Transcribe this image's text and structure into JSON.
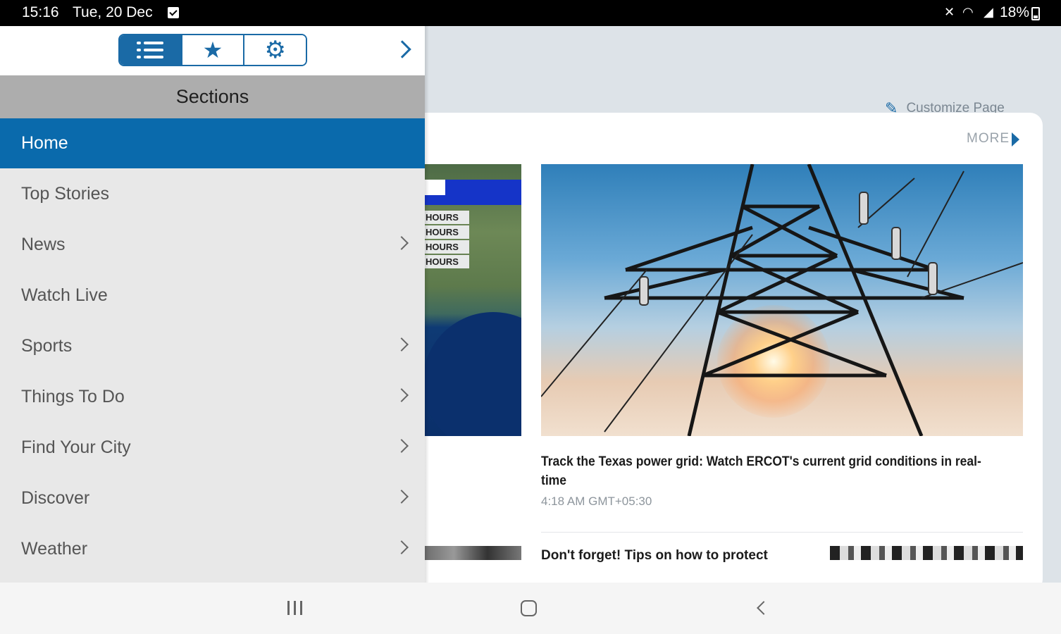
{
  "status_bar": {
    "time": "15:16",
    "date": "Tue, 20 Dec",
    "battery": "18%"
  },
  "toolbar": {
    "tabs": [
      "sections",
      "favorites",
      "settings"
    ],
    "active_tab": "sections"
  },
  "drawer": {
    "header": "Sections",
    "items": [
      {
        "label": "Home",
        "active": true,
        "has_submenu": false
      },
      {
        "label": "Top Stories",
        "active": false,
        "has_submenu": false
      },
      {
        "label": "News",
        "active": false,
        "has_submenu": true
      },
      {
        "label": "Watch Live",
        "active": false,
        "has_submenu": false
      },
      {
        "label": "Sports",
        "active": false,
        "has_submenu": true
      },
      {
        "label": "Things To Do",
        "active": false,
        "has_submenu": true
      },
      {
        "label": "Find Your City",
        "active": false,
        "has_submenu": true
      },
      {
        "label": "Discover",
        "active": false,
        "has_submenu": true
      },
      {
        "label": "Weather",
        "active": false,
        "has_submenu": true
      }
    ]
  },
  "main": {
    "customize_label": "Customize Page",
    "more_label": "MORE",
    "map_hours_labels": [
      "HOURS",
      "HOURS",
      "HOURS",
      "HOURS"
    ],
    "headline": "Track the Texas power grid: Watch ERCOT's current grid conditions in real-time",
    "timestamp": "4:18 AM GMT+05:30",
    "next_headline": "Don't forget! Tips on how to protect"
  },
  "colors": {
    "accent": "#1a6aa6",
    "active_item": "#0a6aac",
    "sections_header": "#adadad",
    "drawer_bg": "#e8e8e8"
  }
}
